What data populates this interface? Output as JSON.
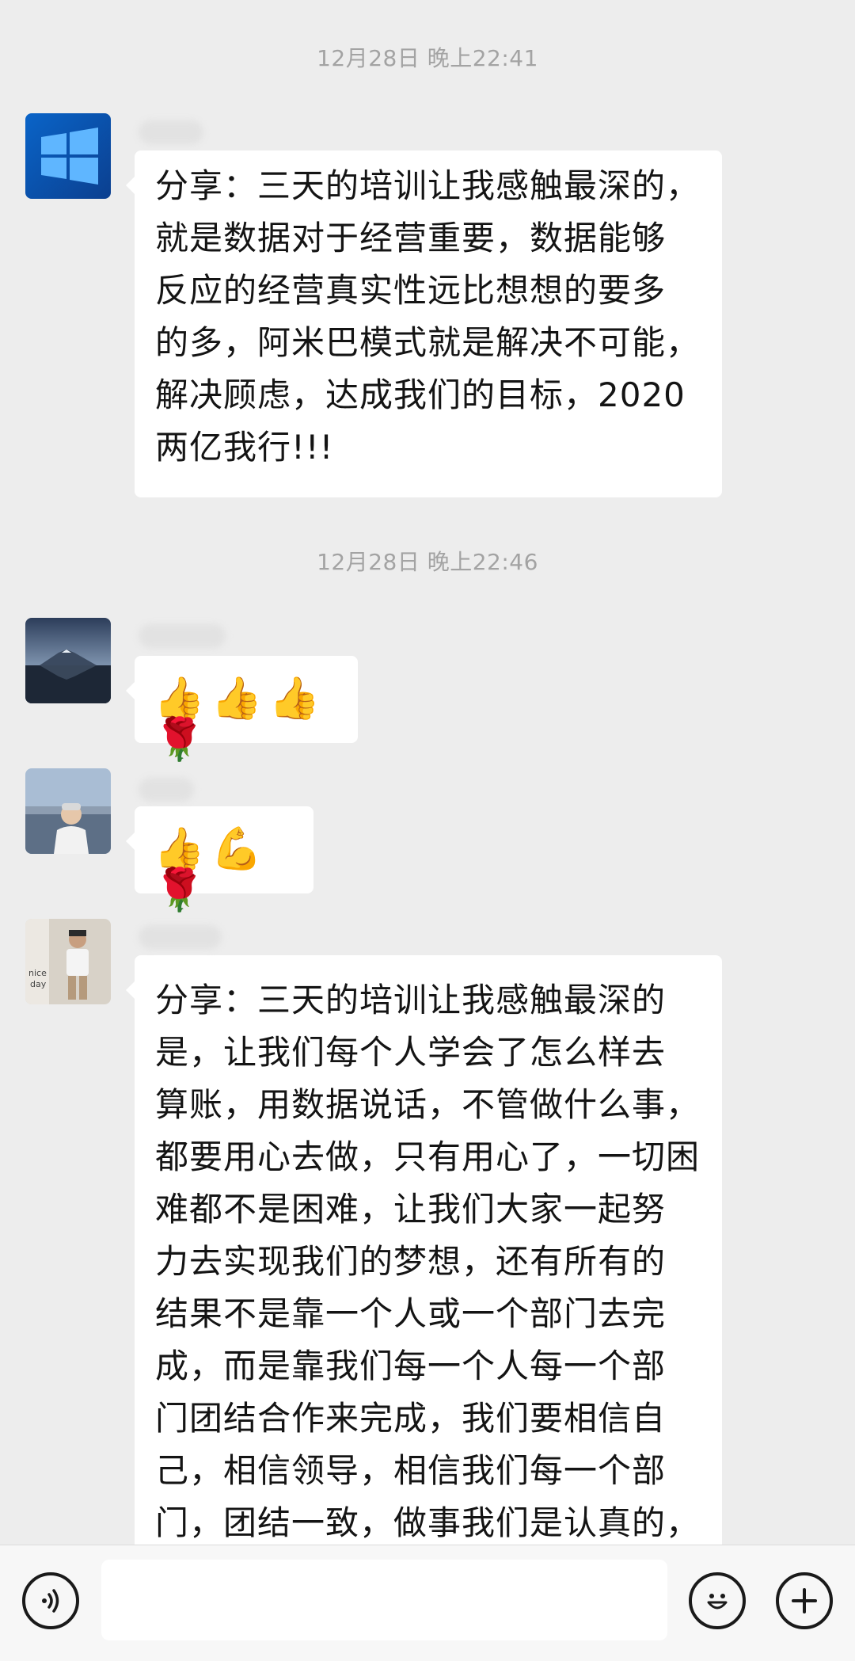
{
  "messages": [
    {
      "timestamp": "12月28日 晚上22:41",
      "text": "分享：三天的培训让我感触最深的，\n就是数据对于经营重要，数据能够\n反应的经营真实性远比想想的要多\n的多，阿米巴模式就是解决不可能，\n解决顾虑，达成我们的目标，2020\n两亿我行!!!"
    },
    {
      "timestamp": "12月28日 晚上22:46",
      "emojis": [
        "👍",
        "👍",
        "👍",
        "🌹"
      ]
    },
    {
      "emojis": [
        "👍",
        "💪",
        "🌹"
      ]
    },
    {
      "text": "分享：三天的培训让我感触最深的\n是，让我们每个人学会了怎么样去\n算账，用数据说话，不管做什么事，\n都要用心去做，只有用心了，一切困\n难都不是困难，让我们大家一起努\n力去实现我们的梦想，还有所有的\n结果不是靠一个人或一个部门去完\n成，而是靠我们每一个人每一个部\n门团结合作来完成，我们要相信自\n己，相信领导，相信我们每一个部\n门，团结一致，做事我们是认真的，"
    }
  ],
  "input_bar": {
    "voice_icon": "voice-icon",
    "emoji_icon": "smiley-icon",
    "add_icon": "plus-icon",
    "input_value": ""
  },
  "colors": {
    "background": "#ededed",
    "bubble": "#ffffff",
    "timestamp": "#a3a3a3"
  }
}
